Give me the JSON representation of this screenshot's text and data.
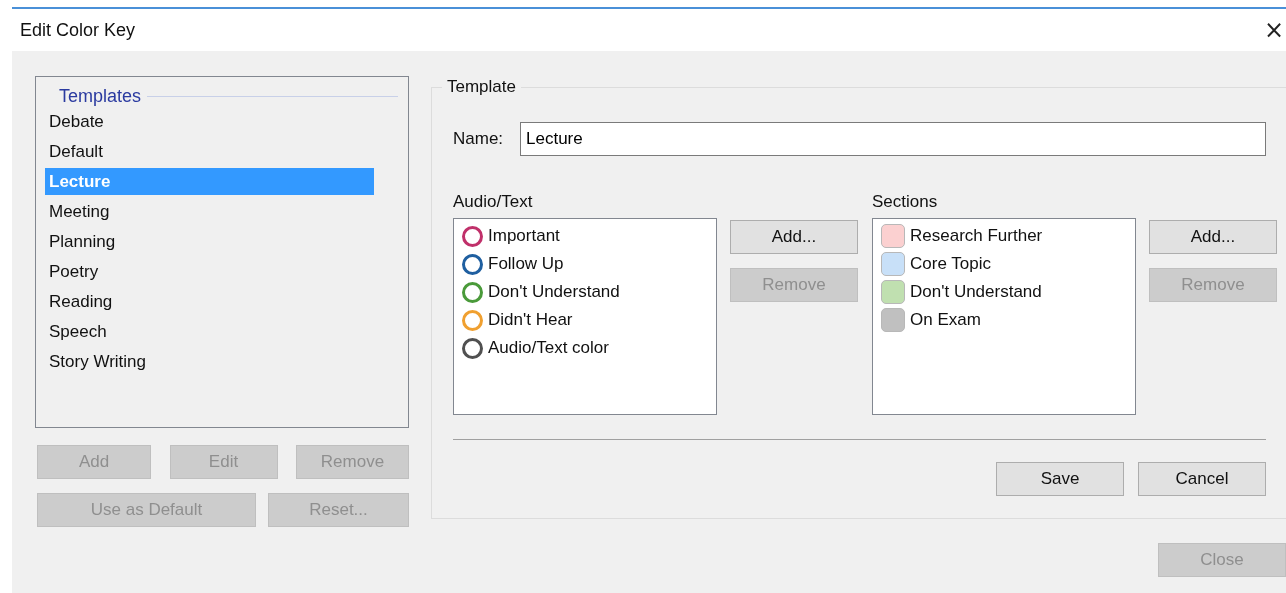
{
  "window": {
    "title": "Edit Color Key",
    "close": "×"
  },
  "templates": {
    "title": "Templates",
    "items": [
      {
        "label": "Debate",
        "selected": false
      },
      {
        "label": "Default",
        "selected": false
      },
      {
        "label": "Lecture",
        "selected": true
      },
      {
        "label": "Meeting",
        "selected": false
      },
      {
        "label": "Planning",
        "selected": false
      },
      {
        "label": "Poetry",
        "selected": false
      },
      {
        "label": "Reading",
        "selected": false
      },
      {
        "label": "Speech",
        "selected": false
      },
      {
        "label": "Story Writing",
        "selected": false
      }
    ],
    "buttons": [
      [
        {
          "label": "Add",
          "disabled": true
        },
        {
          "label": "Edit",
          "disabled": true
        },
        {
          "label": "Remove",
          "disabled": true
        }
      ],
      [
        {
          "label": "Use as Default",
          "disabled": true
        },
        {
          "label": "Reset...",
          "disabled": true
        }
      ]
    ]
  },
  "template": {
    "legend": "Template",
    "name_label": "Name:",
    "name_value": "Lecture",
    "audio_text": {
      "label": "Audio/Text",
      "items": [
        {
          "label": "Important",
          "color": "#c0306a"
        },
        {
          "label": "Follow Up",
          "color": "#1f5fa0"
        },
        {
          "label": "Don't Understand",
          "color": "#4a9a3a"
        },
        {
          "label": "Didn't Hear",
          "color": "#f0a030"
        },
        {
          "label": "Audio/Text color",
          "color": "#505050"
        }
      ],
      "buttons": [
        {
          "label": "Add...",
          "disabled": false
        },
        {
          "label": "Remove",
          "disabled": true
        }
      ]
    },
    "sections": {
      "label": "Sections",
      "items": [
        {
          "label": "Research Further",
          "color": "#fbd0d0"
        },
        {
          "label": "Core Topic",
          "color": "#c8e0f8"
        },
        {
          "label": "Don't Understand",
          "color": "#c0e0b0"
        },
        {
          "label": "On Exam",
          "color": "#c0c0c0"
        }
      ],
      "buttons": [
        {
          "label": "Add...",
          "disabled": false
        },
        {
          "label": "Remove",
          "disabled": true
        }
      ]
    },
    "actions": [
      {
        "label": "Save",
        "disabled": false
      },
      {
        "label": "Cancel",
        "disabled": false
      }
    ]
  },
  "close_button": {
    "label": "Close",
    "disabled": true
  }
}
